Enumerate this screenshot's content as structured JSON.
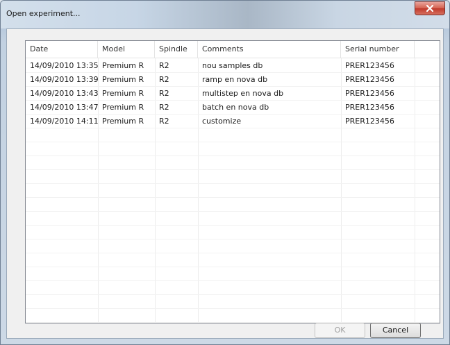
{
  "window": {
    "title": "Open experiment...",
    "close_glyph": "×"
  },
  "table": {
    "columns": [
      "Date",
      "Model",
      "Spindle",
      "Comments",
      "Serial number"
    ],
    "rows": [
      [
        "14/09/2010 13:35",
        "Premium R",
        "R2",
        "nou samples db",
        "PRER123456"
      ],
      [
        "14/09/2010 13:39",
        "Premium R",
        "R2",
        "ramp en nova db",
        "PRER123456"
      ],
      [
        "14/09/2010 13:43",
        "Premium R",
        "R2",
        "multistep en nova db",
        "PRER123456"
      ],
      [
        "14/09/2010 13:47",
        "Premium R",
        "R2",
        "batch en nova db",
        "PRER123456"
      ],
      [
        "14/09/2010 14:11",
        "Premium R",
        "R2",
        "customize",
        "PRER123456"
      ]
    ]
  },
  "buttons": {
    "ok_label": "OK",
    "cancel_label": "Cancel"
  },
  "colors": {
    "close_button": "#c0392b",
    "list_border": "#828790"
  }
}
